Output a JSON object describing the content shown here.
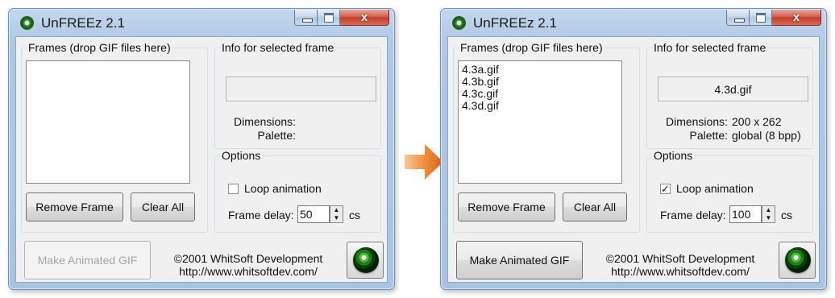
{
  "left_window": {
    "title": "UnFREEz 2.1",
    "frames_group": "Frames (drop GIF files here)",
    "frames": [],
    "info_group": "Info for selected frame",
    "selected_frame_name": "",
    "dimensions_label": "Dimensions:",
    "dimensions_value": "",
    "palette_label": "Palette:",
    "palette_value": "",
    "options_group": "Options",
    "loop_animation_label": "Loop animation",
    "loop_animation_checked": false,
    "frame_delay_label": "Frame delay:",
    "frame_delay_value": "50",
    "frame_delay_unit": "cs",
    "remove_frame_label": "Remove Frame",
    "clear_all_label": "Clear All",
    "make_gif_label": "Make Animated GIF",
    "make_gif_enabled": false,
    "copyright": "©2001 WhitSoft Development",
    "url": "http://www.whitsoftdev.com/"
  },
  "right_window": {
    "title": "UnFREEz 2.1",
    "frames_group": "Frames (drop GIF files here)",
    "frames": [
      "4.3a.gif",
      "4.3b.gif",
      "4.3c.gif",
      "4.3d.gif"
    ],
    "info_group": "Info for selected frame",
    "selected_frame_name": "4.3d.gif",
    "dimensions_label": "Dimensions:",
    "dimensions_value": "200 x 262",
    "palette_label": "Palette:",
    "palette_value": "global (8 bpp)",
    "options_group": "Options",
    "loop_animation_label": "Loop animation",
    "loop_animation_checked": true,
    "frame_delay_label": "Frame delay:",
    "frame_delay_value": "100",
    "frame_delay_unit": "cs",
    "remove_frame_label": "Remove Frame",
    "clear_all_label": "Clear All",
    "make_gif_label": "Make Animated GIF",
    "make_gif_enabled": true,
    "copyright": "©2001 WhitSoft Development",
    "url": "http://www.whitsoftdev.com/"
  },
  "icons": {
    "title_icon": "unfreez-app-icon",
    "transition_arrow": "arrow-right-icon",
    "checkbox_checked_glyph": "✓"
  },
  "colors": {
    "arrow": "#ef7d22",
    "title_bar": "#b6cde7",
    "close_button": "#c33a2b",
    "dialog_face": "#f0f0f0"
  }
}
